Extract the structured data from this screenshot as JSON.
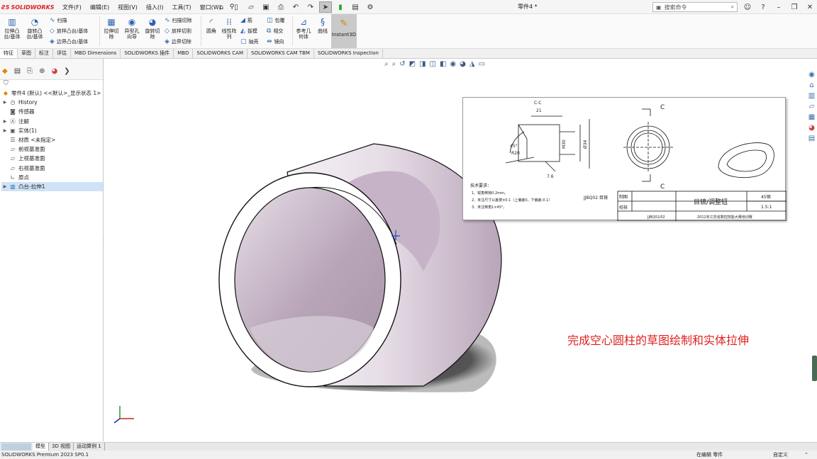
{
  "app": {
    "logo_text": "SOLIDWORKS",
    "doc_title": "零件4 *"
  },
  "menus": [
    "文件(F)",
    "编辑(E)",
    "视图(V)",
    "插入(I)",
    "工具(T)",
    "窗口(W)"
  ],
  "search": {
    "placeholder": "搜索命令"
  },
  "ribbon": {
    "extrude_boss": "拉伸凸\n台/基体",
    "revolve_boss": "旋转凸\n台/基体",
    "sweep": "扫描",
    "loft": "放样凸台/基体",
    "boundary": "边界凸台/基体",
    "extrude_cut": "拉伸切\n除",
    "hole_wizard": "异型孔\n向导",
    "revolve_cut": "旋转切\n除",
    "swept_cut": "扫描切除",
    "lofted_cut": "放样切割",
    "boundary_cut": "边界切除",
    "fillet": "圆角",
    "linear_pattern": "线性阵\n列",
    "rib": "筋",
    "draft": "拔模",
    "shell": "抽壳",
    "wrap": "包覆",
    "intersect": "相交",
    "mirror": "镜向",
    "ref_geometry": "参考几\n何体",
    "curves": "曲线",
    "instant3d": "Instant3D"
  },
  "tabs": [
    "特征",
    "草图",
    "标注",
    "评估",
    "MBD Dimensions",
    "SOLIDWORKS 插件",
    "MBD",
    "SOLIDWORKS CAM",
    "SOLIDWORKS CAM TBM",
    "SOLIDWORKS Inspection"
  ],
  "tree": {
    "root": "零件4 (默认) <<默认>_显示状态 1>",
    "items": [
      "History",
      "传感器",
      "注解",
      "实体(1)",
      "材质 <未指定>",
      "前视基准面",
      "上视基准面",
      "右视基准面",
      "原点",
      "凸台-拉伸1"
    ]
  },
  "annotation_text": "完成空心圆柱的草图绘制和实体拉伸",
  "drawing": {
    "section_label": "C-C",
    "dim_21": "21",
    "dim_7_6": "7.6",
    "dim_m30": "M30",
    "dim_phi34": "Ø34",
    "dim_r20": "R20",
    "dim_45": "45°",
    "view_c": "C",
    "tech_title": "技术要求：",
    "tech_lines": [
      "1、锐角倒钝0.2mm。",
      "2、未注尺寸公差按±0.1（上偏差0，下偏差-0.1）",
      "3、未注倒角1×45°。"
    ],
    "part_code": "JJBQ02 目镜",
    "title_name": "目镜/调整钮",
    "material": "45钢",
    "scale": "1.5:1",
    "drawing_no": "JJBQ01/02",
    "contest": "2012年江苏省数控技能大赛培训赛",
    "label_draw": "制图",
    "label_check": "校核"
  },
  "bottom_tabs": [
    "模型",
    "3D 视图",
    "运动算例 1"
  ],
  "status": {
    "left": "SOLIDWORKS Premium 2023 SP0.1",
    "mid": "在编辑 零件",
    "right": "自定义"
  }
}
